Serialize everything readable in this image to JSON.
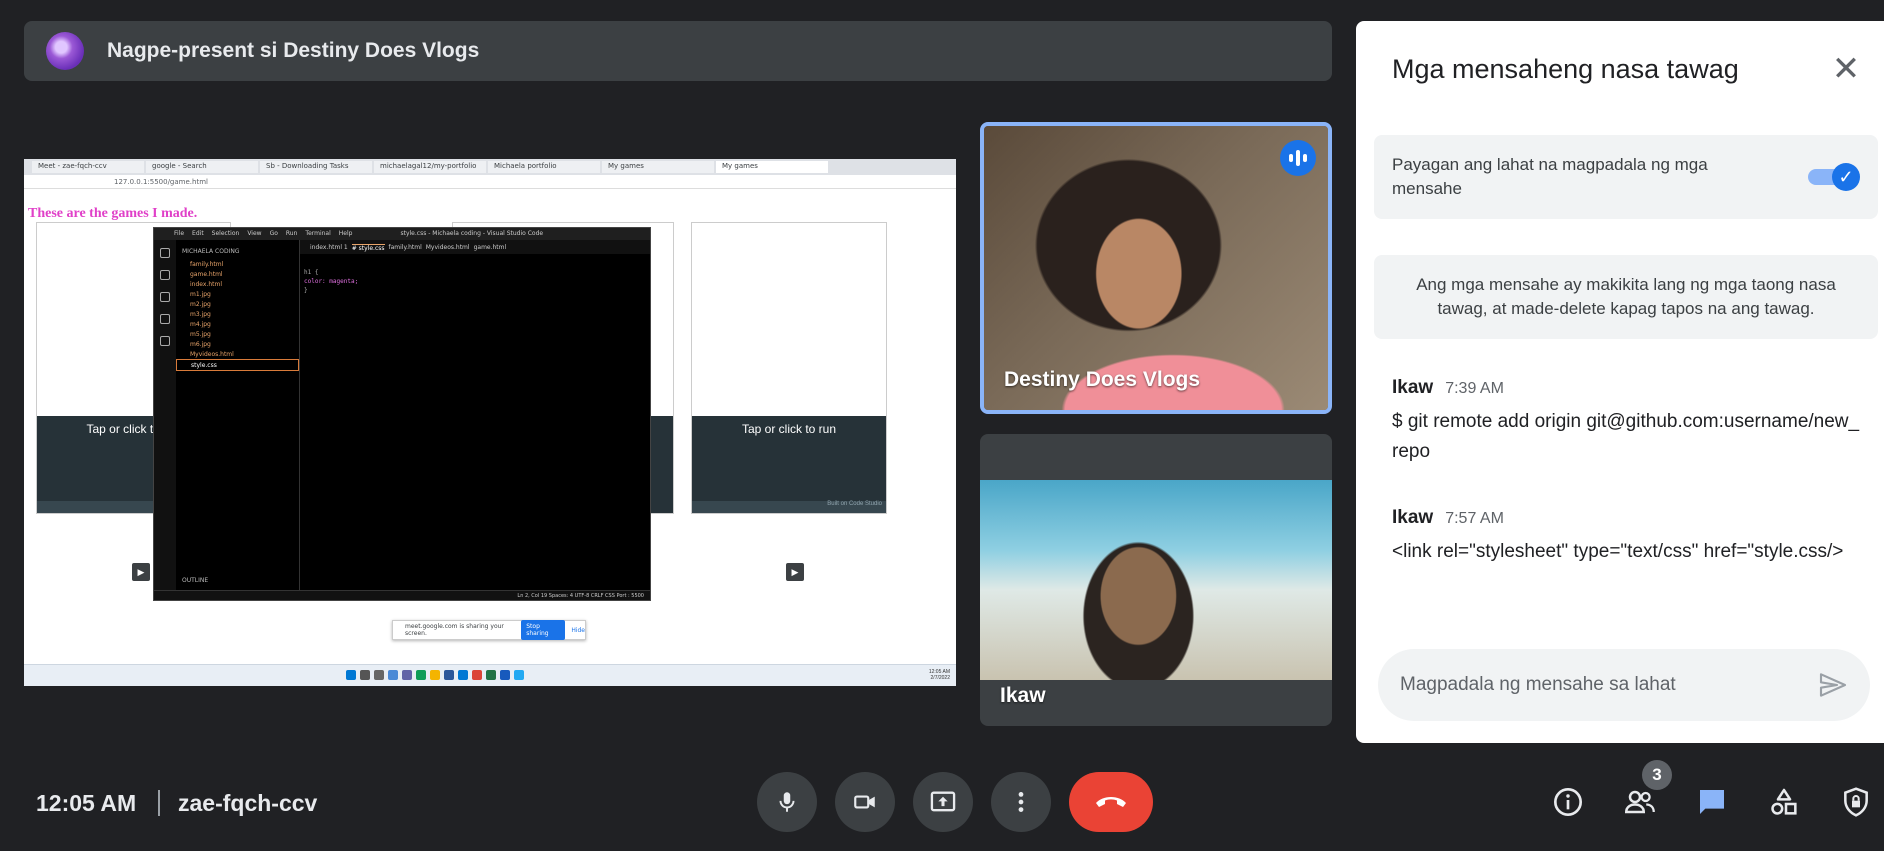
{
  "banner": {
    "text": "Nagpe-present si Destiny Does Vlogs"
  },
  "shared_screen": {
    "browser_tabs": [
      "Meet - zae-fqch-ccv",
      "google - Search",
      "Sb - Downloading Tasks",
      "michaelagal12/my-portfolio",
      "Michaela portfolio",
      "My games",
      "My games"
    ],
    "address": "127.0.0.1:5500/game.html",
    "page_heading": "These are the games I made.",
    "game_cards": [
      {
        "run_label": "Tap or click to run",
        "footer": "Built on Code Studio"
      },
      {
        "run_label": "Tap or click to run",
        "footer": "Built on Code Studio"
      }
    ],
    "vscode": {
      "title": "style.css - Michaela coding - Visual Studio Code",
      "menu": [
        "File",
        "Edit",
        "Selection",
        "View",
        "Go",
        "Run",
        "Terminal",
        "Help"
      ],
      "tabs": [
        "index.html 1",
        "# style.css",
        "family.html",
        "Myvideos.html",
        "game.html"
      ],
      "explorer_header": "MICHAELA CODING",
      "files": [
        "family.html",
        "game.html",
        "index.html",
        "m1.jpg",
        "m2.jpg",
        "m3.jpg",
        "m4.jpg",
        "m5.jpg",
        "m6.jpg",
        "Myvideos.html",
        "style.css"
      ],
      "code_lines": [
        "h1 {",
        "    color: magenta;",
        "}"
      ],
      "status": "Ln 2, Col 19   Spaces: 4   UTF-8   CRLF   CSS   Port : 5500",
      "outline": "OUTLINE"
    },
    "share_bar": {
      "text": "meet.google.com is sharing your screen.",
      "stop": "Stop sharing",
      "hide": "Hide"
    },
    "taskbar_time": "12:05 AM",
    "taskbar_date": "2/7/2022"
  },
  "tiles": [
    {
      "name": "Destiny Does Vlogs",
      "speaking": true
    },
    {
      "name": "Ikaw",
      "speaking": false
    }
  ],
  "chat": {
    "title": "Mga mensaheng nasa tawag",
    "toggle_label": "Payagan ang lahat na magpadala ng mga mensahe",
    "toggle_on": true,
    "info": "Ang mga mensahe ay makikita lang ng mga taong nasa tawag, at made-delete kapag tapos na ang tawag.",
    "messages": [
      {
        "sender": "Ikaw",
        "time": "7:39 AM",
        "text": "$ git remote add origin git@github.com:username/new_repo"
      },
      {
        "sender": "Ikaw",
        "time": "7:57 AM",
        "text": "<link rel=\"stylesheet\" type=\"text/css\" href=\"style.css/>"
      }
    ],
    "input_placeholder": "Magpadala ng mensahe sa lahat"
  },
  "bottom_bar": {
    "time": "12:05 AM",
    "meeting_code": "zae-fqch-ccv",
    "participants_count": "3"
  },
  "colors": {
    "accent": "#1a73e8",
    "end_call": "#ea4335",
    "background": "#202124"
  }
}
